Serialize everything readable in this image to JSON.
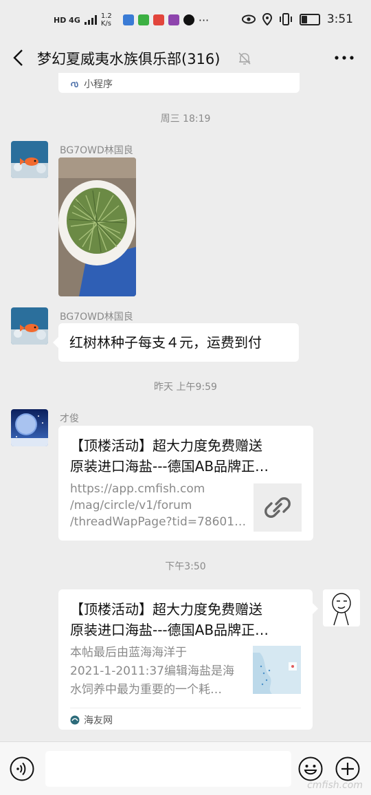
{
  "status_bar": {
    "left_text": "HD 4G",
    "net_speed": "1.2 K/s",
    "more": "···",
    "time": "3:51",
    "battery_fraction": 0.35
  },
  "header": {
    "title": "梦幻夏威夷水族俱乐部(316)"
  },
  "mini_program_card": {
    "label": "小程序"
  },
  "messages": [
    {
      "timestamp": "周三 18:19",
      "sender": "BG7OWD林国良",
      "type": "image"
    },
    {
      "sender": "BG7OWD林国良",
      "type": "text",
      "text": "红树林种子每支４元，运费到付"
    },
    {
      "timestamp": "昨天 上午9:59",
      "sender": "才俊",
      "type": "link",
      "title": "【顶楼活动】超大力度免费赠送原装进口海盐---德国AB品牌正…",
      "title_line1": "【顶楼活动】超大力度免费赠送",
      "title_line2": "原装进口海盐---德国AB品牌正…",
      "desc_line1": "https://app.cmfish.com",
      "desc_line2": "/mag/circle/v1/forum",
      "desc_line3": "/threadWapPage?tid=78601…",
      "thumb_icon": "link-icon"
    },
    {
      "timestamp": "下午3:50",
      "type": "link",
      "self": true,
      "title_line1": "【顶楼活动】超大力度免费赠送",
      "title_line2": "原装进口海盐---德国AB品牌正…",
      "desc_line1": "本帖最后由蓝海海洋于",
      "desc_line2": "2021-1-2011:37编辑海盐是海",
      "desc_line3": "水饲养中最为重要的一个耗…",
      "source": "海友网"
    }
  ],
  "input": {
    "placeholder": ""
  },
  "watermark": "cmfish.com",
  "colors": {
    "background": "#ededed",
    "bubble": "#ffffff",
    "meta_text": "#8a8a8a",
    "link_thumb_bg": "#ededed"
  }
}
